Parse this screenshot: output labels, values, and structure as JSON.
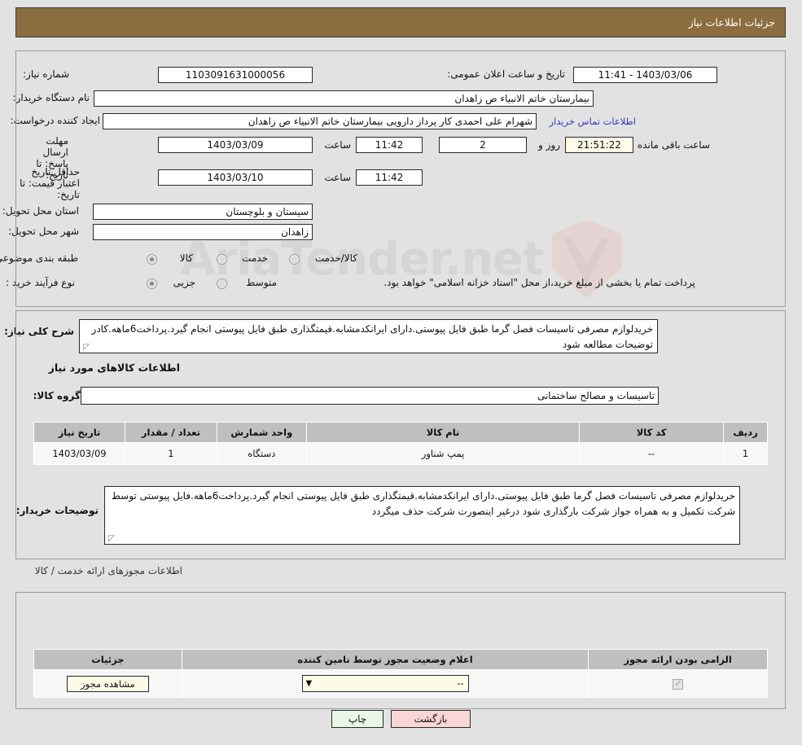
{
  "header": {
    "title": "جزئیات اطلاعات نیاز"
  },
  "watermark": {
    "text": "AriaTender.net"
  },
  "form": {
    "need_number": {
      "label": "شماره نیاز:",
      "value": "1103091631000056"
    },
    "public_announce": {
      "label": "تاریخ و ساعت اعلان عمومی:",
      "value": "1403/03/06 - 11:41"
    },
    "buyer_org": {
      "label": "نام دستگاه خریدار:",
      "value": "بیمارستان خاتم الانبیاء  ص  زاهدان"
    },
    "requester": {
      "label": "ایجاد کننده درخواست:",
      "value": "شهرام علی احمدی  کار پرداز دارویی  بیمارستان خاتم الانبیاء  ص  زاهدان"
    },
    "contact_link": "اطلاعات تماس خریدار",
    "reply_deadline": {
      "label": "مهلت ارسال پاسخ: تا تاریخ:",
      "date": "1403/03/09",
      "time_label": "ساعت",
      "time": "11:42",
      "days": "2",
      "days_label": "روز و",
      "countdown": "21:51:22",
      "remaining_label": "ساعت باقی مانده"
    },
    "price_validity": {
      "label": "حداقل تاریخ اعتبار قیمت: تا تاریخ:",
      "date": "1403/03/10",
      "time_label": "ساعت",
      "time": "11:42"
    },
    "delivery_province": {
      "label": "استان محل تحویل:",
      "value": "سیستان و بلوچستان"
    },
    "delivery_city": {
      "label": "شهر محل تحویل:",
      "value": "زاهدان"
    },
    "subject_category": {
      "label": "طبقه بندی موضوعی:",
      "options": [
        "کالا",
        "خدمت",
        "کالا/خدمت"
      ],
      "selected": "کالا"
    },
    "purchase_process": {
      "label": "نوع فرآیند خرید :",
      "options": [
        "جزیی",
        "متوسط"
      ],
      "selected": "جزیی",
      "note": "پرداخت تمام یا بخشی از مبلغ خرید،از محل \"اسناد خزانه اسلامی\" خواهد بود."
    }
  },
  "need_summary": {
    "label": "شرح کلی نیاز:",
    "value": "خریدلوازم مصرفی تاسیسات فصل گرما طبق فایل پیوستی.دارای ایرانکدمشابه.قیمتگذاری طبق فایل پیوستی انجام گیرد.پرداخت6ماهه.کادر توضیحات مطالعه شود"
  },
  "items_section": {
    "title": "اطلاعات کالاهای مورد نیاز",
    "group_label": "گروه کالا:",
    "group_value": "تاسیسات و مصالح ساختمانی",
    "columns": [
      "ردیف",
      "کد کالا",
      "نام کالا",
      "واحد شمارش",
      "تعداد / مقدار",
      "تاریخ نیاز"
    ],
    "rows": [
      {
        "row": "1",
        "code": "--",
        "name": "پمپ شناور",
        "unit": "دستگاه",
        "qty": "1",
        "need_date": "1403/03/09"
      }
    ]
  },
  "buyer_notes": {
    "label": "توضیحات خریدار:",
    "value": "خریدلوازم مصرفی تاسیسات فصل گرما طبق فایل پیوستی.دارای ایرانکدمشابه.قیمتگذاری طبق فایل پیوستی انجام گیرد.پرداخت6ماهه.فایل پیوستی توسط شرکت تکمیل و به همراه جواز شرکت بارگذاری شود درغیر اینصورت شرکت حذف میگردد"
  },
  "permits_section": {
    "title": "اطلاعات مجوزهای ارائه خدمت / کالا",
    "columns": [
      "الزامی بودن ارائه مجوز",
      "اعلام وضعیت مجوز توسط تامین کننده",
      "جزئیات"
    ],
    "rows": [
      {
        "required": true,
        "status_value": "--",
        "detail_label": "مشاهده مجوز"
      }
    ]
  },
  "footer": {
    "print_label": "چاپ",
    "back_label": "بازگشت"
  }
}
